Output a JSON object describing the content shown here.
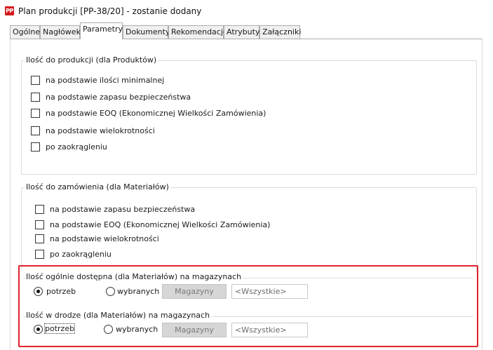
{
  "window": {
    "icon_text": "PP",
    "title": "Plan produkcji [PP-38/20] - zostanie dodany"
  },
  "tabs": [
    {
      "label": "Ogólne"
    },
    {
      "label": "Nagłówek"
    },
    {
      "label": "Parametry"
    },
    {
      "label": "Dokumenty"
    },
    {
      "label": "Rekomendacje"
    },
    {
      "label": "Atrybuty"
    },
    {
      "label": "Załączniki"
    }
  ],
  "active_tab": "Parametry",
  "production_group": {
    "legend": "Ilość do produkcji (dla Produktów)",
    "options": [
      {
        "label": "na podstawie ilości minimalnej",
        "checked": false
      },
      {
        "label": "na podstawie zapasu bezpieczeństwa",
        "checked": false
      },
      {
        "label": "na podstawie EOQ (Ekonomicznej Wielkości Zamówienia)",
        "checked": false
      },
      {
        "label": "na podstawie wielokrotności",
        "checked": false
      },
      {
        "label": "po zaokrągleniu",
        "checked": false
      }
    ]
  },
  "order_group": {
    "legend": "Ilość do zamówienia (dla Materiałów)",
    "options": [
      {
        "label": "na podstawie zapasu bezpieczeństwa",
        "checked": false
      },
      {
        "label": "na podstawie EOQ (Ekonomicznej Wielkości Zamówienia)",
        "checked": false
      },
      {
        "label": "na podstawie wielokrotności",
        "checked": false
      },
      {
        "label": "po zaokrągleniu",
        "checked": false
      }
    ]
  },
  "available_group": {
    "legend": "Ilość ogólnie dostępna (dla Materiałów) na magazynach",
    "radio_needs": "potrzeb",
    "radio_selected": "wybranych",
    "selected_option": "potrzeb",
    "button": "Magazyny",
    "field_value": "<Wszystkie>"
  },
  "transit_group": {
    "legend": "Ilość w drodze (dla Materiałów) na magazynach",
    "radio_needs": "potrzeb",
    "radio_selected": "wybranych",
    "selected_option": "potrzeb",
    "button": "Magazyny",
    "field_value": "<Wszystkie>"
  },
  "colors": {
    "highlight_border": "#e0222b",
    "app_icon": "#d6191b"
  }
}
